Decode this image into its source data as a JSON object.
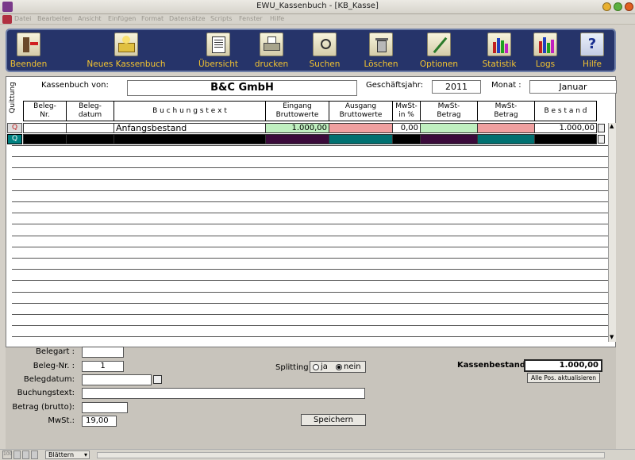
{
  "window": {
    "title": "EWU_Kassenbuch - [KB_Kasse]"
  },
  "menu": [
    "Datei",
    "Bearbeiten",
    "Ansicht",
    "Einfügen",
    "Format",
    "Datensätze",
    "Scripts",
    "Fenster",
    "Hilfe"
  ],
  "toolbar": [
    {
      "label": "Beenden",
      "icon": "exit-door-icon"
    },
    {
      "label": "Neues Kassenbuch",
      "icon": "new-book-icon"
    },
    {
      "label": "Übersicht",
      "icon": "overview-icon"
    },
    {
      "label": "drucken",
      "icon": "printer-icon"
    },
    {
      "label": "Suchen",
      "icon": "search-icon"
    },
    {
      "label": "Löschen",
      "icon": "trash-icon"
    },
    {
      "label": "Optionen",
      "icon": "wrench-icon"
    },
    {
      "label": "Statistik",
      "icon": "bar-chart-icon"
    },
    {
      "label": "Logs",
      "icon": "log-chart-icon"
    },
    {
      "label": "Hilfe",
      "icon": "help-icon"
    }
  ],
  "header": {
    "quittung": "Quittung",
    "kassenbuch_label": "Kassenbuch von:",
    "kassenbuch_value": "B&C GmbH",
    "geschaeftsjahr_label": "Geschäftsjahr:",
    "geschaeftsjahr_value": "2011",
    "monat_label": "Monat :",
    "monat_value": "Januar"
  },
  "columns": [
    "Beleg-\nNr.",
    "Beleg-\ndatum",
    "B u c h u n g s t e x t",
    "Eingang\nBruttowerte",
    "Ausgang\nBruttowerte",
    "MwSt-\nin %",
    "MwSt-\nBetrag",
    "MwSt-\nBetrag",
    "B e s t a n d"
  ],
  "rows": [
    {
      "belegnr": "",
      "belegdatum": "",
      "text": "Anfangsbestand",
      "eingang": "1.000,00",
      "ausgang": "",
      "mwst_pct": "0,00",
      "mwst1": "",
      "mwst2": "",
      "bestand": "1.000,00"
    }
  ],
  "colors": {
    "eingang": "#c0f0c0",
    "ausgang": "#f0a0a0",
    "mwst1": "#c0f0c0",
    "mwst2": "#f0a0a0",
    "toolbar": "#26346a",
    "toolbar_label": "#f4c430"
  },
  "form": {
    "belegart_label": "Belegart :",
    "belegart_value": "",
    "belegnr_label": "Beleg-Nr. :",
    "belegnr_value": "1",
    "belegdatum_label": "Belegdatum:",
    "belegdatum_value": "",
    "buchungstext_label": "Buchungstext:",
    "buchungstext_value": "",
    "betrag_label": "Betrag (brutto):",
    "betrag_value": "",
    "mwst_label": "MwSt.:",
    "mwst_value": "19,00",
    "splitting_label": "Splitting",
    "splitting_ja": "ja",
    "splitting_nein": "nein",
    "splitting_selected": "nein",
    "kassenbestand_label": "Kassenbestand:",
    "kassenbestand_value": "1.000,00",
    "alle_pos_button": "Alle Pos. aktualisieren",
    "save_button": "Speichern"
  },
  "status": {
    "zoom": "100",
    "mode": "Blättern"
  }
}
